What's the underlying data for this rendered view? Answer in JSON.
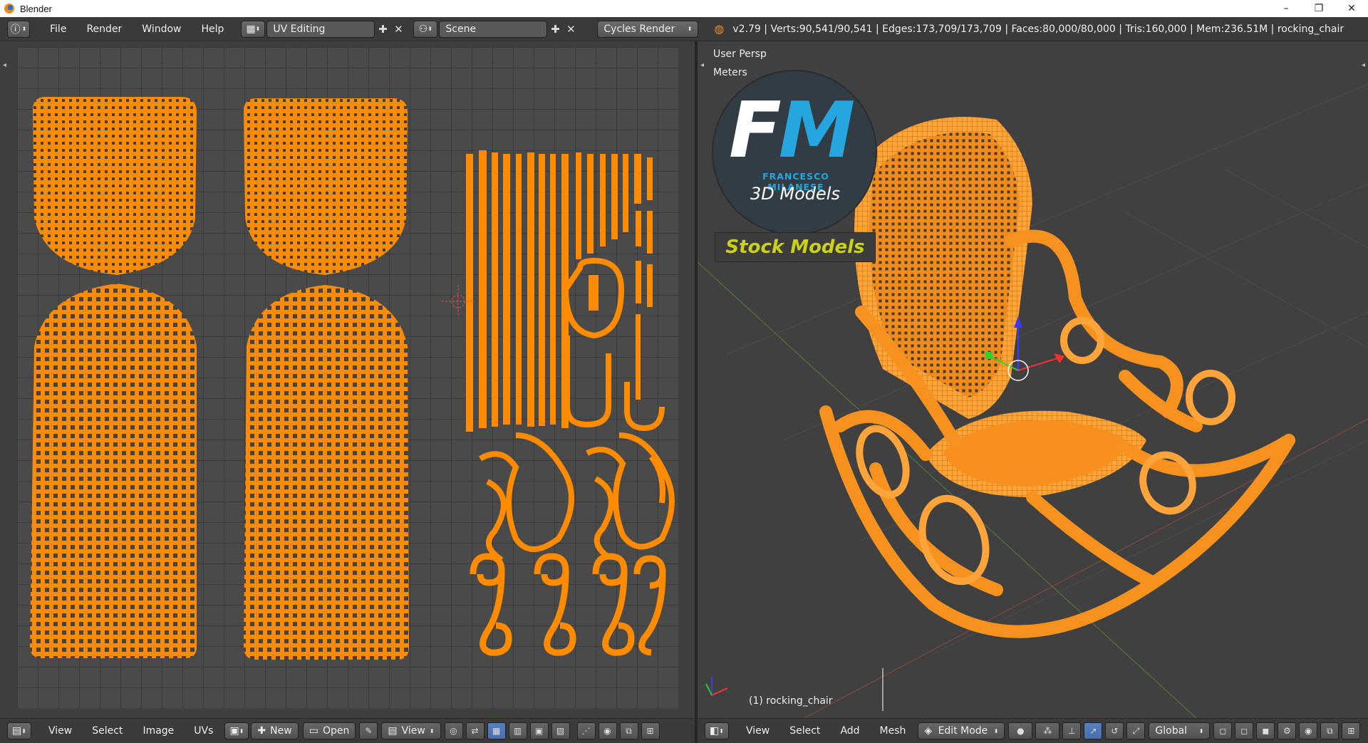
{
  "window": {
    "title": "Blender",
    "controls": {
      "minimize": "–",
      "maximize": "❐",
      "close": "✕"
    }
  },
  "info_header": {
    "menus": [
      "File",
      "Render",
      "Window",
      "Help"
    ],
    "screen_layout": "UV Editing",
    "scene": "Scene",
    "render_engine": "Cycles Render",
    "stats": "v2.79 | Verts:90,541/90,541 | Edges:173,709/173,709 | Faces:80,000/80,000 | Tris:160,000 | Mem:236.51M | rocking_chair"
  },
  "uv_editor": {
    "menus": [
      "View",
      "Select",
      "Image",
      "UVs"
    ],
    "new_label": "New",
    "open_label": "Open",
    "view_label": "View"
  },
  "viewport": {
    "view_name": "User Persp",
    "units": "Meters",
    "object_label": "(1) rocking_chair",
    "menus": [
      "View",
      "Select",
      "Add",
      "Mesh"
    ],
    "mode": "Edit Mode",
    "orientation": "Global"
  },
  "watermark": {
    "letter_f": "F",
    "letter_m": "M",
    "name": "FRANCESCO MILANESE",
    "subtitle": "3D Models",
    "tagline": "Stock Models"
  },
  "colors": {
    "accent_orange": "#ff8c00",
    "header_bg": "#3a3a3a",
    "logo_blue": "#25a6de",
    "logo_green": "#c8d21a"
  }
}
